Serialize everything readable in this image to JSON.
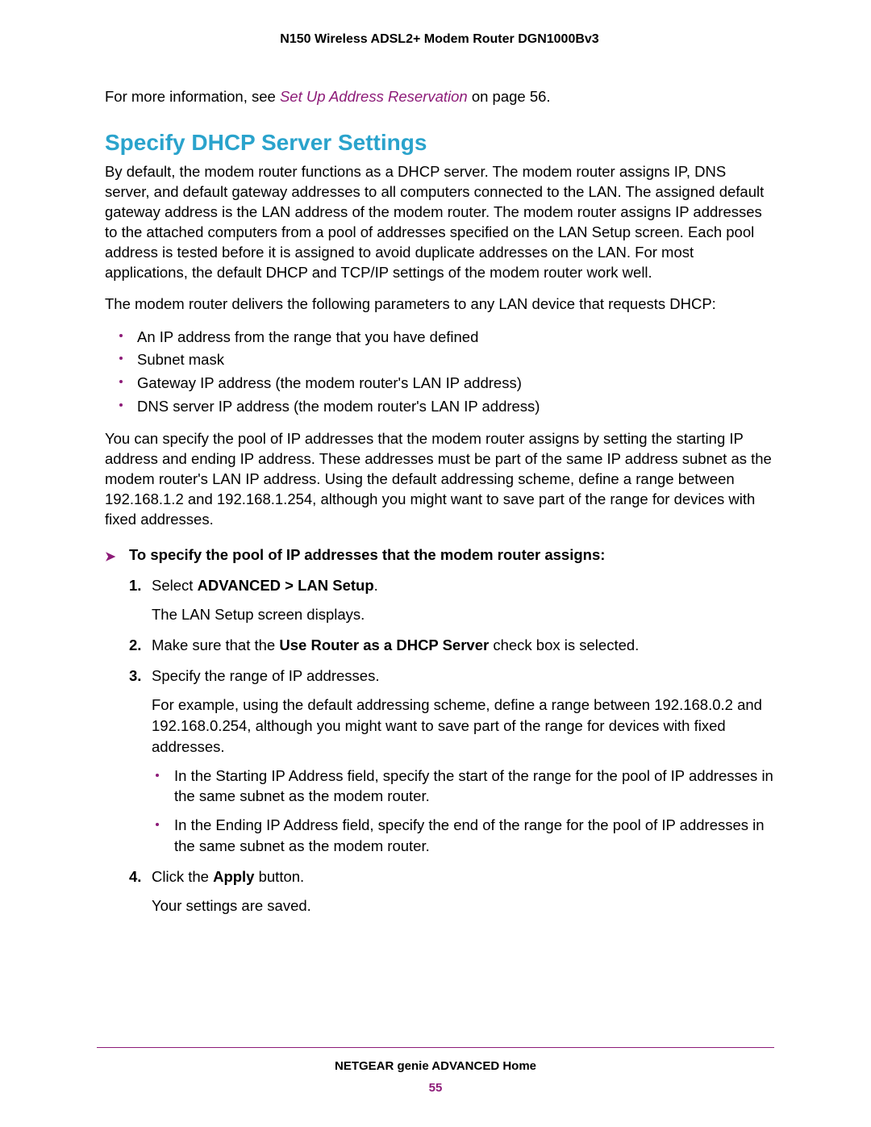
{
  "header": {
    "product": "N150 Wireless ADSL2+ Modem Router DGN1000Bv3"
  },
  "intro": {
    "prefix": "For more information, see ",
    "link": "Set Up Address Reservation",
    "suffix": " on page 56."
  },
  "section": {
    "heading": "Specify DHCP Server Settings",
    "p1": "By default, the modem router functions as a DHCP server. The modem router assigns IP, DNS server, and default gateway addresses to all computers connected to the LAN. The assigned default gateway address is the LAN address of the modem router. The modem router assigns IP addresses to the attached computers from a pool of addresses specified on the LAN Setup screen. Each pool address is tested before it is assigned to avoid duplicate addresses on the LAN. For most applications, the default DHCP and TCP/IP settings of the modem router work well.",
    "p2": "The modem router delivers the following parameters to any LAN device that requests DHCP:",
    "bullets": [
      "An IP address from the range that you have defined",
      "Subnet mask",
      "Gateway IP address (the modem router's LAN IP address)",
      "DNS server IP address (the modem router's LAN IP address)"
    ],
    "p3": "You can specify the pool of IP addresses that the modem router assigns by setting the starting IP address and ending IP address. These addresses must be part of the same IP address subnet as the modem router's LAN IP address. Using the default addressing scheme, define a range between 192.168.1.2 and 192.168.1.254, although you might want to save part of the range for devices with fixed addresses."
  },
  "procedure": {
    "title": "To specify the pool of IP addresses that the modem router assigns:",
    "steps": {
      "s1_prefix": "Select ",
      "s1_bold": "ADVANCED > LAN Setup",
      "s1_suffix": ".",
      "s1_sub": "The LAN Setup screen displays.",
      "s2_prefix": "Make sure that the ",
      "s2_bold": "Use Router as a DHCP Server",
      "s2_suffix": " check box is selected.",
      "s3": "Specify the range of IP addresses.",
      "s3_sub": "For example, using the default addressing scheme, define a range between 192.168.0.2 and 192.168.0.254, although you might want to save part of the range for devices with fixed addresses.",
      "s3_b1": "In the Starting IP Address field, specify the start of the range for the pool of IP addresses in the same subnet as the modem router.",
      "s3_b2": "In the Ending IP Address field, specify the end of the range for the pool of IP addresses in the same subnet as the modem router.",
      "s4_prefix": "Click the ",
      "s4_bold": "Apply",
      "s4_suffix": " button.",
      "s4_sub": "Your settings are saved."
    },
    "numbers": {
      "n1": "1.",
      "n2": "2.",
      "n3": "3.",
      "n4": "4."
    }
  },
  "footer": {
    "title": "NETGEAR genie ADVANCED Home",
    "page": "55"
  }
}
